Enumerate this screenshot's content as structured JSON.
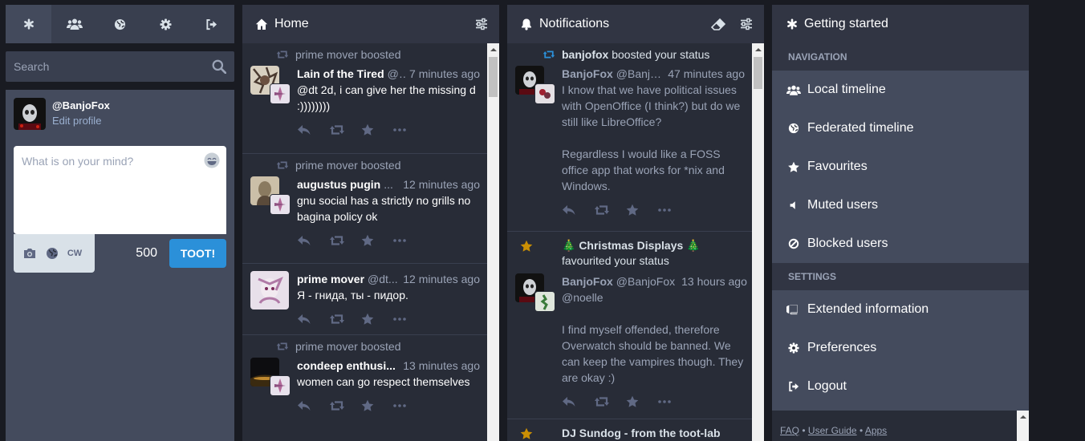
{
  "drawer": {
    "tabs": [
      {
        "icon": "asterisk-icon",
        "title": "Getting started"
      },
      {
        "icon": "users-icon",
        "title": "Local timeline"
      },
      {
        "icon": "globe-icon",
        "title": "Federated timeline"
      },
      {
        "icon": "gear-icon",
        "title": "Preferences"
      },
      {
        "icon": "logout-icon",
        "title": "Logout"
      }
    ],
    "search_placeholder": "Search",
    "account": {
      "handle": "@BanjoFox",
      "edit": "Edit profile"
    },
    "compose": {
      "placeholder": "What is on your mind?",
      "cw": "CW",
      "counter": "500",
      "toot": "TOOT!"
    }
  },
  "home": {
    "title": "Home",
    "statuses": [
      {
        "boost": "prime mover boosted",
        "name": "Lain of the Tired",
        "handle": "@...",
        "time": "7 minutes ago",
        "content": "@dt 2d, i can give her the missing d :))))))))"
      },
      {
        "boost": "prime mover boosted",
        "name": "augustus pugin",
        "handle": "...",
        "time": "12 minutes ago",
        "content": "gnu social has a strictly no grills no bagina policy ok"
      },
      {
        "boost": "",
        "name": "prime mover",
        "handle": "@dt...",
        "time": "12 minutes ago",
        "content": "Я - гнида, ты - пидор."
      },
      {
        "boost": "prime mover boosted",
        "name": "condeep enthusi...",
        "handle": "",
        "time": "13 minutes ago",
        "content": "women can go respect themselves"
      }
    ]
  },
  "notifications": {
    "title": "Notifications",
    "items": [
      {
        "kind": "boost",
        "who": "banjofox",
        "action": "boosted your status",
        "name": "BanjoFox",
        "handle": "@Banjo...",
        "time": "47 minutes ago",
        "p1": "I know that we have political issues with OpenOffice (I think?) but do we still like LibreOffice?",
        "p2": "Regardless I would like a FOSS office app that works for *nix and Windows."
      },
      {
        "kind": "favourite",
        "who": "🎄 Christmas Displays 🎄",
        "action": "favourited your status",
        "name": "BanjoFox",
        "handle": "@BanjoFox",
        "time": "13 hours ago",
        "p1": "@noelle",
        "p2": "I find myself offended, therefore Overwatch should be banned. We can keep the vampires though. They are okay :)"
      },
      {
        "kind": "favourite",
        "who": "DJ Sundog - from the toot-lab",
        "action": "",
        "name": "",
        "handle": "",
        "time": "",
        "p1": "",
        "p2": ""
      }
    ]
  },
  "getting_started": {
    "title": "Getting started",
    "navigation_label": "Navigation",
    "nav": [
      {
        "icon": "users-icon",
        "label": "Local timeline"
      },
      {
        "icon": "globe-icon",
        "label": "Federated timeline"
      },
      {
        "icon": "star-icon",
        "label": "Favourites"
      },
      {
        "icon": "volume-off-icon",
        "label": "Muted users"
      },
      {
        "icon": "ban-icon",
        "label": "Blocked users"
      }
    ],
    "settings_label": "Settings",
    "settings": [
      {
        "icon": "book-icon",
        "label": "Extended information"
      },
      {
        "icon": "gear-icon",
        "label": "Preferences"
      },
      {
        "icon": "logout-icon",
        "label": "Logout"
      }
    ],
    "footer": {
      "faq": "FAQ",
      "sep1": "•",
      "guide": "User Guide",
      "sep2": "•",
      "apps": "Apps"
    }
  },
  "colors": {
    "accent": "#2b90d9",
    "star": "#ca8f04",
    "boost": "#2b90d9"
  }
}
